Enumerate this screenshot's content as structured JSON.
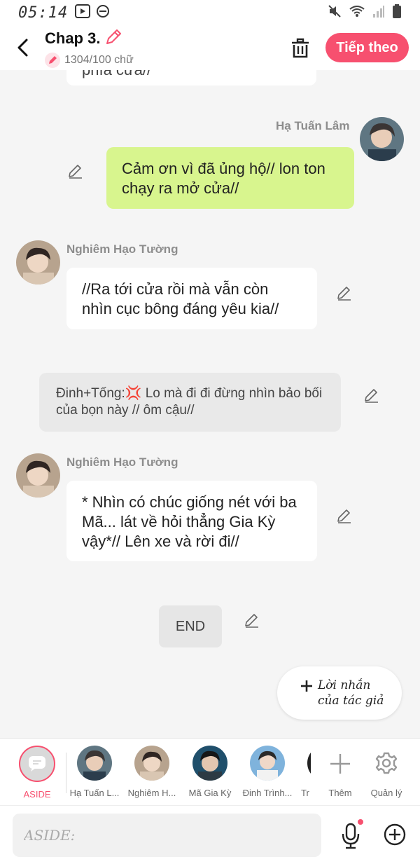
{
  "status_bar": {
    "time": "05:14"
  },
  "header": {
    "title": "Chap 3.",
    "word_count": "1304/100 chữ",
    "next_label": "Tiếp theo"
  },
  "messages": [
    {
      "type": "right",
      "author": "Hạ Tuấn Lâm",
      "text": "Cảm ơn vì đã ủng hộ// lon ton chạy ra mở cửa//"
    },
    {
      "type": "left",
      "author": "Nghiêm Hạo Tường",
      "text": "//Ra tới cửa rồi mà vẫn còn nhìn cục bông đáng yêu kia//"
    },
    {
      "type": "aside",
      "text": "Đinh+Tống:💢 Lo mà đi đi đừng nhìn bảo bối của bọn này // ôm cậu//"
    },
    {
      "type": "left",
      "author": "Nghiêm Hạo Tường",
      "text": "* Nhìn có chúc giống nét với ba Mã... lát về hỏi thẳng Gia Kỳ vậy*// Lên xe và rời đi//"
    }
  ],
  "partial_top_text": "phía cửa//",
  "end_label": "END",
  "author_note": {
    "line1": "Lời nhắn",
    "line2": "của tác giả"
  },
  "characters": [
    {
      "label": "ASIDE"
    },
    {
      "label": "Hạ Tuấn L..."
    },
    {
      "label": "Nghiêm H..."
    },
    {
      "label": "Mã Gia Kỳ"
    },
    {
      "label": "Đinh Trình..."
    },
    {
      "label": "Tr"
    }
  ],
  "actions": {
    "add_label": "Thêm",
    "manage_label": "Quản lý"
  },
  "composer": {
    "placeholder": "ASIDE:"
  },
  "colors": {
    "accent": "#f7506f",
    "green_bubble": "#d8f58e"
  }
}
